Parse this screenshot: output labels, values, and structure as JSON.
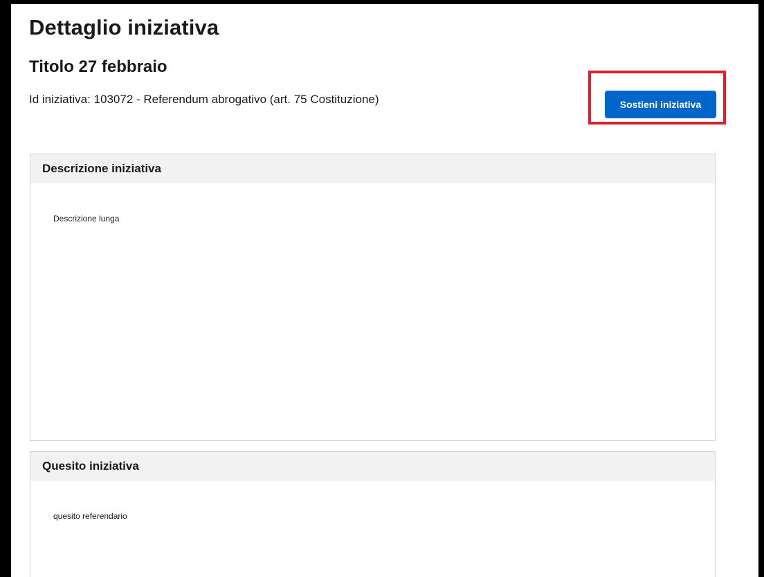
{
  "header": {
    "page_title": "Dettaglio iniziativa",
    "initiative_title": "Titolo 27 febbraio",
    "meta": "Id iniziativa: 103072 - Referendum abrogativo (art. 75 Costituzione)"
  },
  "actions": {
    "support_label": "Sostieni iniziativa"
  },
  "sections": {
    "description": {
      "title": "Descrizione iniziativa",
      "body": "Descrizione lunga"
    },
    "question": {
      "title": "Quesito iniziativa",
      "body": "quesito referendario"
    }
  },
  "colors": {
    "primary": "#0066cc",
    "highlight": "#e0202e",
    "card_header_bg": "#f2f2f2"
  }
}
